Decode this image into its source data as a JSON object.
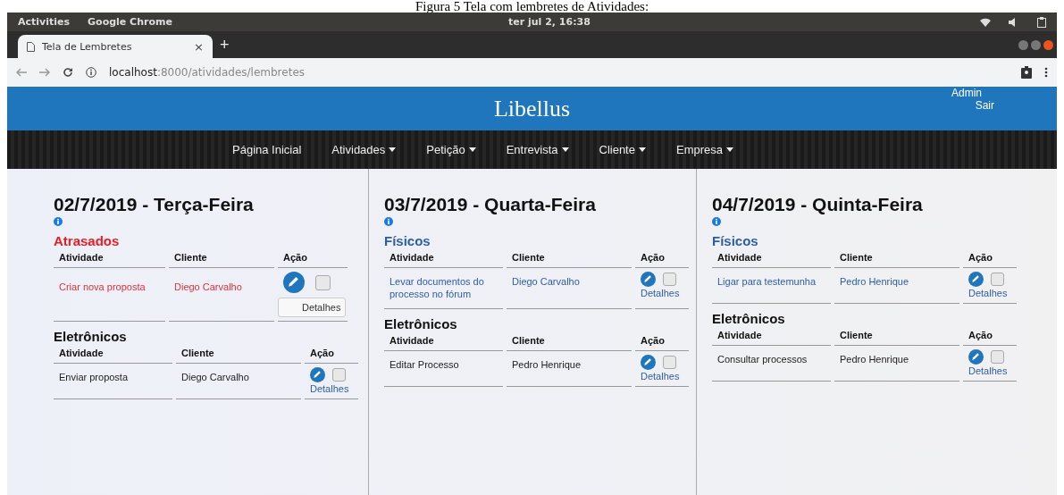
{
  "caption": "Figura 5 Tela com lembretes de Atividades:",
  "system_bar": {
    "activities": "Activities",
    "app": "Google Chrome",
    "clock": "ter jul  2, 16:38"
  },
  "browser": {
    "tabs": [
      {
        "title": "Tela de Lembretes",
        "close": "×",
        "selected": true
      }
    ],
    "new_tab": "+",
    "url_host": "localhost",
    "url_path": ":8000/atividades/lembretes"
  },
  "header": {
    "logo": "Libellus",
    "user": "Admin",
    "logout": "Sair"
  },
  "nav": [
    {
      "label": "Página Inicial",
      "dropdown": false
    },
    {
      "label": "Atividades",
      "dropdown": true
    },
    {
      "label": "Petição",
      "dropdown": true
    },
    {
      "label": "Entrevista",
      "dropdown": true
    },
    {
      "label": "Cliente",
      "dropdown": true
    },
    {
      "label": "Empresa",
      "dropdown": true
    }
  ],
  "days": [
    {
      "title": "02/7/2019 - Terça-Feira",
      "sections": [
        {
          "kind": "late",
          "title": "Atrasados",
          "columns": [
            "Atividade",
            "Cliente",
            "Ação"
          ],
          "rows": [
            {
              "activity": "Criar nova proposta",
              "client": "Diego Carvalho",
              "checked": false,
              "details": "Detalhes"
            }
          ]
        },
        {
          "kind": "electronic",
          "title": "Eletrônicos",
          "columns": [
            "Atividade",
            "Cliente",
            "Ação"
          ],
          "rows": [
            {
              "activity": "Enviar proposta",
              "client": "Diego Carvalho",
              "checked": false,
              "details": "Detalhes"
            }
          ]
        }
      ]
    },
    {
      "title": "03/7/2019 - Quarta-Feira",
      "sections": [
        {
          "kind": "physical",
          "title": "Físicos",
          "columns": [
            "Atividade",
            "Cliente",
            "Ação"
          ],
          "rows": [
            {
              "activity": "Levar documentos do processo no fórum",
              "client": "Diego Carvalho",
              "checked": false,
              "details": "Detalhes"
            }
          ]
        },
        {
          "kind": "electronic",
          "title": "Eletrônicos",
          "columns": [
            "Atividade",
            "Cliente",
            "Ação"
          ],
          "rows": [
            {
              "activity": "Editar Processo",
              "client": "Pedro Henrique",
              "checked": false,
              "details": "Detalhes"
            }
          ]
        }
      ]
    },
    {
      "title": "04/7/2019 - Quinta-Feira",
      "sections": [
        {
          "kind": "physical",
          "title": "Físicos",
          "columns": [
            "Atividade",
            "Cliente",
            "Ação"
          ],
          "rows": [
            {
              "activity": "Ligar para testemunha",
              "client": "Pedro Henrique",
              "checked": false,
              "details": "Detalhes"
            }
          ]
        },
        {
          "kind": "electronic",
          "title": "Eletrônicos",
          "columns": [
            "Atividade",
            "Cliente",
            "Ação"
          ],
          "rows": [
            {
              "activity": "Consultar processos",
              "client": "Pedro Henrique",
              "checked": false,
              "details": "Detalhes"
            }
          ]
        }
      ]
    }
  ]
}
